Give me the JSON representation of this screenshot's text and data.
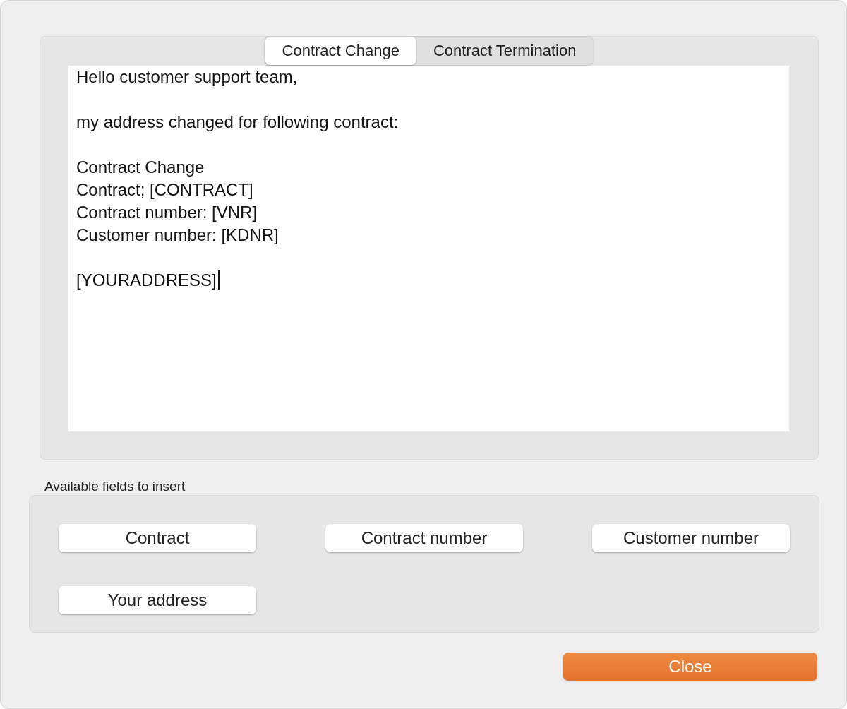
{
  "tabs": [
    {
      "label": "Contract Change",
      "selected": true
    },
    {
      "label": "Contract Termination",
      "selected": false
    }
  ],
  "editor": {
    "paragraphs": [
      [
        "Hello customer support team,"
      ],
      [
        "my address changed for following contract:"
      ],
      [
        "Contract Change",
        "Contract; [CONTRACT]",
        "Contract number: [VNR]",
        "Customer number: [KDNR]"
      ],
      [
        "[YOURADDRESS]"
      ]
    ],
    "caret": true
  },
  "fields_group": {
    "label": "Available fields to insert",
    "buttons": [
      "Contract",
      "Contract number",
      "Customer number",
      "Your address"
    ]
  },
  "buttons": [
    "Close"
  ]
}
